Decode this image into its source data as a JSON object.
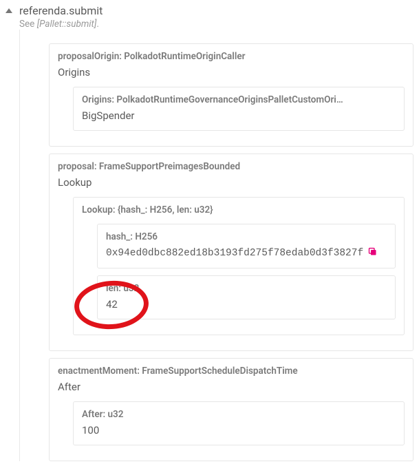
{
  "header": {
    "title": "referenda.submit",
    "subtitle_prefix": "See ",
    "subtitle_link": "[Pallet::submit]",
    "subtitle_suffix": "."
  },
  "proposalOrigin": {
    "label": "proposalOrigin: PolkadotRuntimeOriginCaller",
    "value": "Origins",
    "child": {
      "label": "Origins: PolkadotRuntimeGovernanceOriginsPalletCustomOri…",
      "value": "BigSpender"
    }
  },
  "proposal": {
    "label": "proposal: FrameSupportPreimagesBounded",
    "value": "Lookup",
    "lookup": {
      "label": "Lookup: {hash_: H256, len: u32}",
      "hash": {
        "label": "hash_: H256",
        "value": "0x94ed0dbc882ed18b3193fd275f78edab0d3f3827f"
      },
      "len": {
        "label": "len: u32",
        "value": "42"
      }
    }
  },
  "enactmentMoment": {
    "label": "enactmentMoment: FrameSupportScheduleDispatchTime",
    "value": "After",
    "child": {
      "label": "After: u32",
      "value": "100"
    }
  },
  "colors": {
    "accent": "#e6007a",
    "annotation": "#e0131a"
  }
}
